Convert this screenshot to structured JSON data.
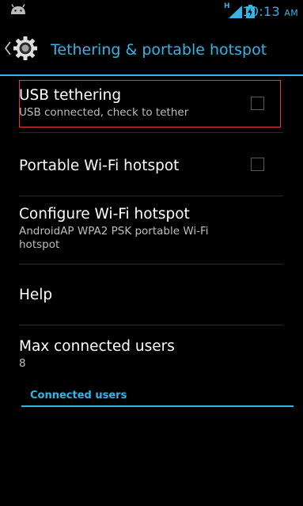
{
  "status_bar": {
    "time": "10:13",
    "ampm": "AM",
    "network_label": "H",
    "accent_color": "#33b5e5"
  },
  "action_bar": {
    "title": "Tethering & portable hotspot",
    "icon": "settings-gear-icon"
  },
  "settings": {
    "usb_tethering": {
      "title": "USB tethering",
      "summary": "USB connected, check to tether",
      "checked": false
    },
    "wifi_hotspot": {
      "title": "Portable Wi-Fi hotspot",
      "checked": false
    },
    "configure_hotspot": {
      "title": "Configure Wi-Fi hotspot",
      "summary": "AndroidAP WPA2 PSK portable Wi-Fi hotspot"
    },
    "help": {
      "title": "Help"
    },
    "max_users": {
      "title": "Max connected users",
      "value": "8"
    },
    "connected_users_header": "Connected users"
  }
}
